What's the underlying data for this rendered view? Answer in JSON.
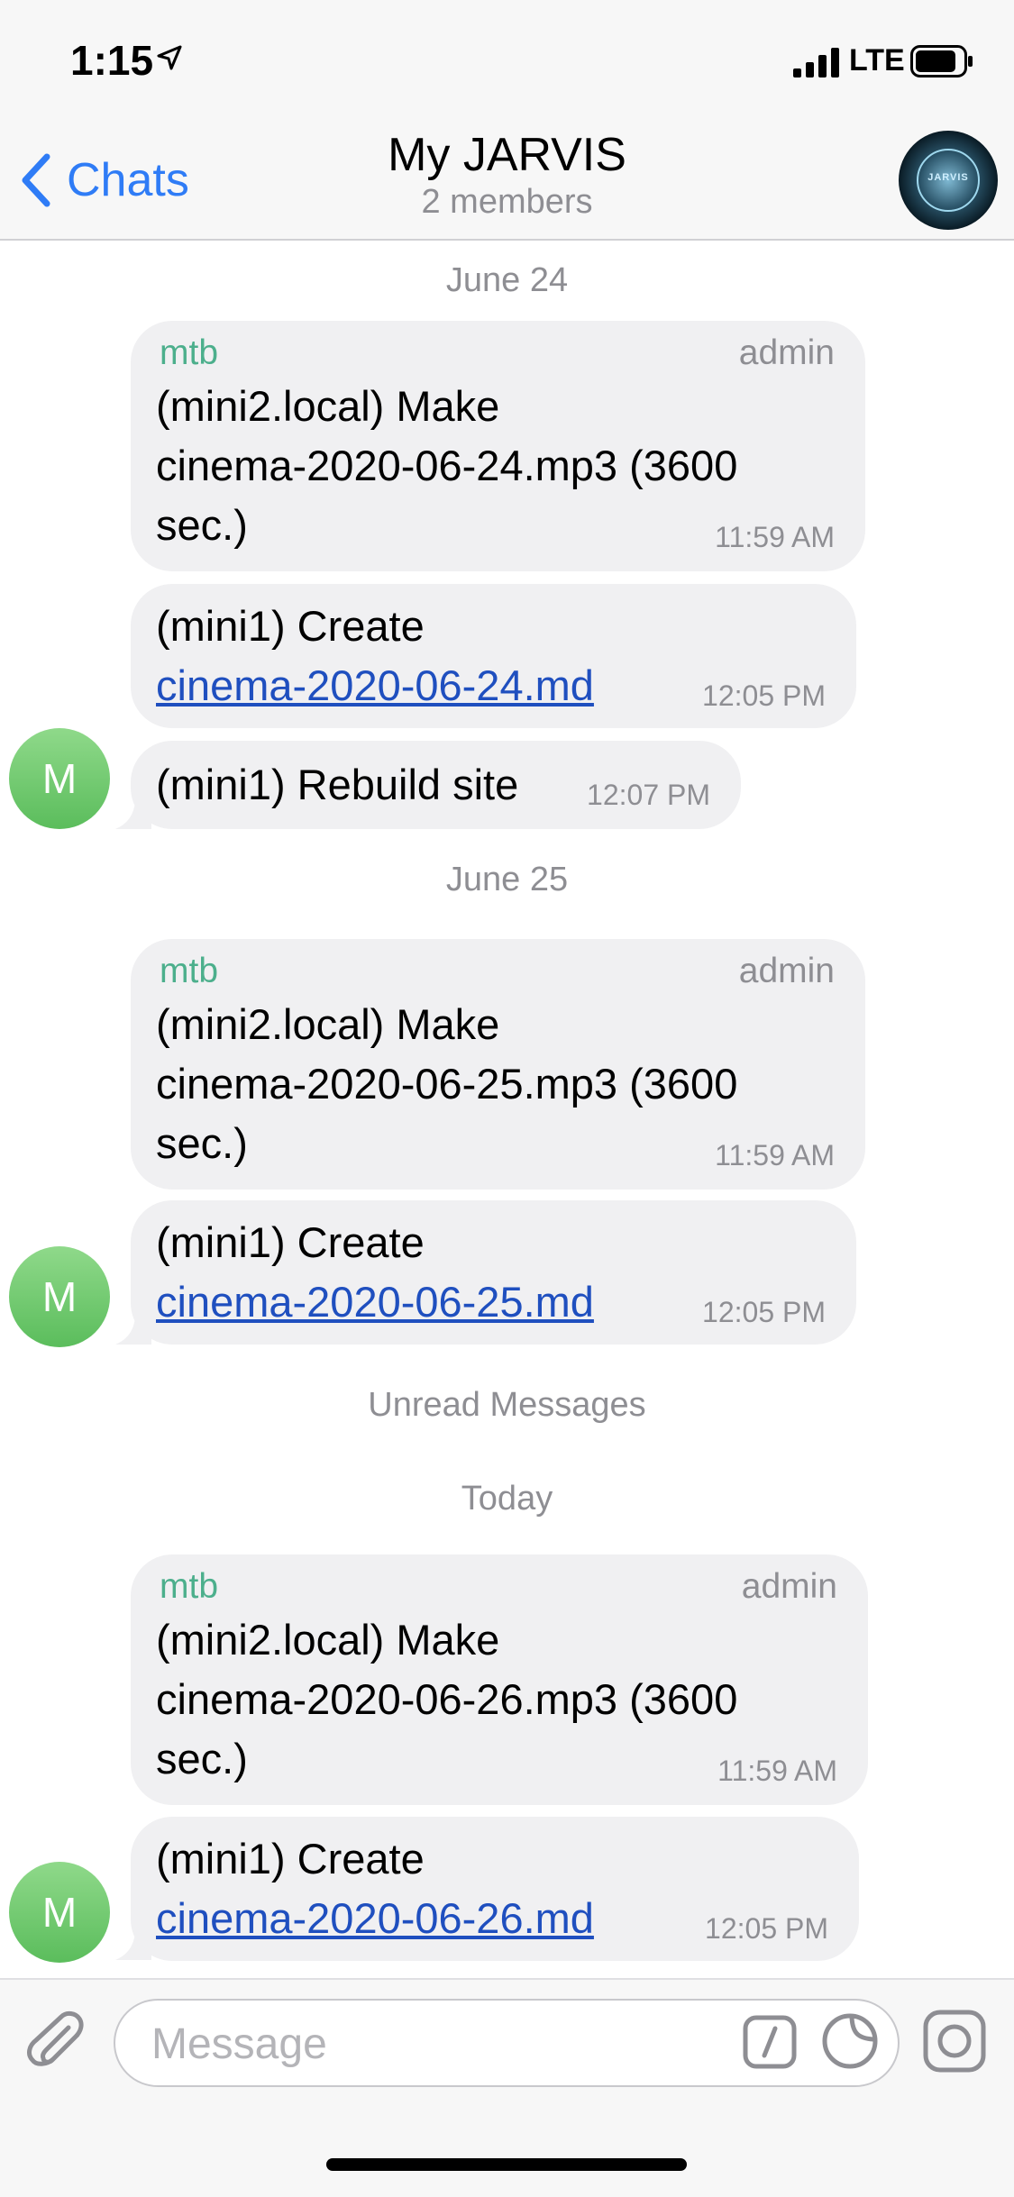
{
  "status_bar": {
    "time": "1:15",
    "network": "LTE"
  },
  "nav": {
    "back_label": "Chats",
    "title": "My JARVIS",
    "subtitle": "2 members",
    "avatar_text": "JARVIS"
  },
  "dates": {
    "d1": "June 24",
    "d2": "June 25",
    "unread": "Unread Messages",
    "today": "Today"
  },
  "messages": {
    "m1": {
      "sender": "mtb",
      "role": "admin",
      "line1": "(mini2.local) Make",
      "line2": "cinema-2020-06-24.mp3 (3600",
      "line3": "sec.)",
      "time": "11:59 AM"
    },
    "m2": {
      "line1": "(mini1) Create",
      "link": "cinema-2020-06-24.md",
      "time": "12:05 PM"
    },
    "m3": {
      "line1": "(mini1) Rebuild site",
      "time": "12:07 PM"
    },
    "m4": {
      "sender": "mtb",
      "role": "admin",
      "line1": "(mini2.local) Make",
      "line2": "cinema-2020-06-25.mp3 (3600",
      "line3": "sec.)",
      "time": "11:59 AM"
    },
    "m5": {
      "line1": "(mini1) Create",
      "link": "cinema-2020-06-25.md",
      "time": "12:05 PM"
    },
    "m6": {
      "sender": "mtb",
      "role": "admin",
      "line1": "(mini2.local) Make",
      "line2": "cinema-2020-06-26.mp3 (3600",
      "line3": "sec.)",
      "time": "11:59 AM"
    },
    "m7": {
      "line1": "(mini1) Create",
      "link": "cinema-2020-06-26.md",
      "time": "12:05 PM"
    }
  },
  "avatar_initial": "M",
  "input": {
    "placeholder": "Message"
  },
  "colors": {
    "accent": "#2f7cf6",
    "sender": "#4caf8c",
    "bubble": "#f0f0f2",
    "link": "#1f4fbf",
    "avatar": "#6ec46b"
  },
  "icons": [
    "location-arrow-icon",
    "signal-icon",
    "battery-icon",
    "chevron-left-icon",
    "paperclip-icon",
    "slash-command-icon",
    "sticker-icon",
    "camera-icon"
  ]
}
